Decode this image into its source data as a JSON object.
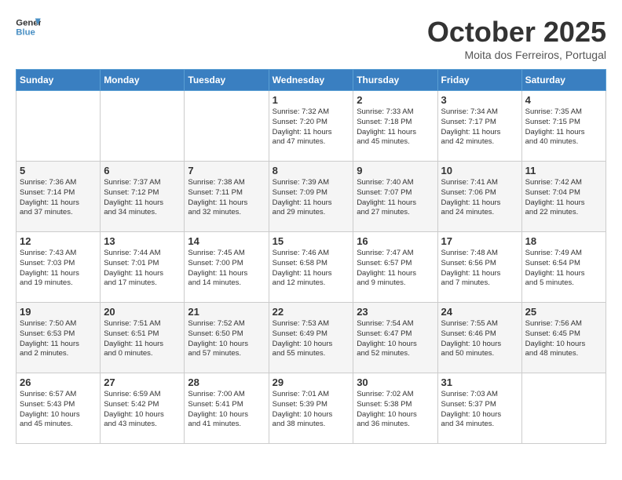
{
  "header": {
    "logo_line1": "General",
    "logo_line2": "Blue",
    "month": "October 2025",
    "location": "Moita dos Ferreiros, Portugal"
  },
  "weekdays": [
    "Sunday",
    "Monday",
    "Tuesday",
    "Wednesday",
    "Thursday",
    "Friday",
    "Saturday"
  ],
  "weeks": [
    [
      {
        "day": "",
        "info": ""
      },
      {
        "day": "",
        "info": ""
      },
      {
        "day": "",
        "info": ""
      },
      {
        "day": "1",
        "info": "Sunrise: 7:32 AM\nSunset: 7:20 PM\nDaylight: 11 hours\nand 47 minutes."
      },
      {
        "day": "2",
        "info": "Sunrise: 7:33 AM\nSunset: 7:18 PM\nDaylight: 11 hours\nand 45 minutes."
      },
      {
        "day": "3",
        "info": "Sunrise: 7:34 AM\nSunset: 7:17 PM\nDaylight: 11 hours\nand 42 minutes."
      },
      {
        "day": "4",
        "info": "Sunrise: 7:35 AM\nSunset: 7:15 PM\nDaylight: 11 hours\nand 40 minutes."
      }
    ],
    [
      {
        "day": "5",
        "info": "Sunrise: 7:36 AM\nSunset: 7:14 PM\nDaylight: 11 hours\nand 37 minutes."
      },
      {
        "day": "6",
        "info": "Sunrise: 7:37 AM\nSunset: 7:12 PM\nDaylight: 11 hours\nand 34 minutes."
      },
      {
        "day": "7",
        "info": "Sunrise: 7:38 AM\nSunset: 7:11 PM\nDaylight: 11 hours\nand 32 minutes."
      },
      {
        "day": "8",
        "info": "Sunrise: 7:39 AM\nSunset: 7:09 PM\nDaylight: 11 hours\nand 29 minutes."
      },
      {
        "day": "9",
        "info": "Sunrise: 7:40 AM\nSunset: 7:07 PM\nDaylight: 11 hours\nand 27 minutes."
      },
      {
        "day": "10",
        "info": "Sunrise: 7:41 AM\nSunset: 7:06 PM\nDaylight: 11 hours\nand 24 minutes."
      },
      {
        "day": "11",
        "info": "Sunrise: 7:42 AM\nSunset: 7:04 PM\nDaylight: 11 hours\nand 22 minutes."
      }
    ],
    [
      {
        "day": "12",
        "info": "Sunrise: 7:43 AM\nSunset: 7:03 PM\nDaylight: 11 hours\nand 19 minutes."
      },
      {
        "day": "13",
        "info": "Sunrise: 7:44 AM\nSunset: 7:01 PM\nDaylight: 11 hours\nand 17 minutes."
      },
      {
        "day": "14",
        "info": "Sunrise: 7:45 AM\nSunset: 7:00 PM\nDaylight: 11 hours\nand 14 minutes."
      },
      {
        "day": "15",
        "info": "Sunrise: 7:46 AM\nSunset: 6:58 PM\nDaylight: 11 hours\nand 12 minutes."
      },
      {
        "day": "16",
        "info": "Sunrise: 7:47 AM\nSunset: 6:57 PM\nDaylight: 11 hours\nand 9 minutes."
      },
      {
        "day": "17",
        "info": "Sunrise: 7:48 AM\nSunset: 6:56 PM\nDaylight: 11 hours\nand 7 minutes."
      },
      {
        "day": "18",
        "info": "Sunrise: 7:49 AM\nSunset: 6:54 PM\nDaylight: 11 hours\nand 5 minutes."
      }
    ],
    [
      {
        "day": "19",
        "info": "Sunrise: 7:50 AM\nSunset: 6:53 PM\nDaylight: 11 hours\nand 2 minutes."
      },
      {
        "day": "20",
        "info": "Sunrise: 7:51 AM\nSunset: 6:51 PM\nDaylight: 11 hours\nand 0 minutes."
      },
      {
        "day": "21",
        "info": "Sunrise: 7:52 AM\nSunset: 6:50 PM\nDaylight: 10 hours\nand 57 minutes."
      },
      {
        "day": "22",
        "info": "Sunrise: 7:53 AM\nSunset: 6:49 PM\nDaylight: 10 hours\nand 55 minutes."
      },
      {
        "day": "23",
        "info": "Sunrise: 7:54 AM\nSunset: 6:47 PM\nDaylight: 10 hours\nand 52 minutes."
      },
      {
        "day": "24",
        "info": "Sunrise: 7:55 AM\nSunset: 6:46 PM\nDaylight: 10 hours\nand 50 minutes."
      },
      {
        "day": "25",
        "info": "Sunrise: 7:56 AM\nSunset: 6:45 PM\nDaylight: 10 hours\nand 48 minutes."
      }
    ],
    [
      {
        "day": "26",
        "info": "Sunrise: 6:57 AM\nSunset: 5:43 PM\nDaylight: 10 hours\nand 45 minutes."
      },
      {
        "day": "27",
        "info": "Sunrise: 6:59 AM\nSunset: 5:42 PM\nDaylight: 10 hours\nand 43 minutes."
      },
      {
        "day": "28",
        "info": "Sunrise: 7:00 AM\nSunset: 5:41 PM\nDaylight: 10 hours\nand 41 minutes."
      },
      {
        "day": "29",
        "info": "Sunrise: 7:01 AM\nSunset: 5:39 PM\nDaylight: 10 hours\nand 38 minutes."
      },
      {
        "day": "30",
        "info": "Sunrise: 7:02 AM\nSunset: 5:38 PM\nDaylight: 10 hours\nand 36 minutes."
      },
      {
        "day": "31",
        "info": "Sunrise: 7:03 AM\nSunset: 5:37 PM\nDaylight: 10 hours\nand 34 minutes."
      },
      {
        "day": "",
        "info": ""
      }
    ]
  ]
}
